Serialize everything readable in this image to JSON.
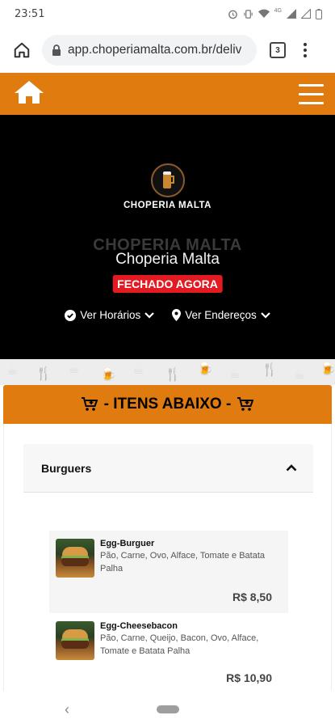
{
  "status_bar": {
    "time": "23:51",
    "network_label": "4G"
  },
  "browser": {
    "url": "app.choperiamalta.com.br/deliv",
    "tab_count": "3"
  },
  "site_nav": {
    "home_icon": "home-icon",
    "menu_icon": "hamburger-icon"
  },
  "hero": {
    "logo_text": "CHOPERIA MALTA",
    "ghost_title": "CHOPERIA MALTA",
    "store_name": "Choperia Malta",
    "status_badge": "FECHADO AGORA",
    "links": [
      {
        "label": "Ver Horários",
        "icon": "check-circle-icon"
      },
      {
        "label": "Ver Endereços",
        "icon": "map-pin-icon"
      }
    ]
  },
  "items_header": {
    "label": "- ITENS ABAIXO -",
    "icon": "cart-icon"
  },
  "category": {
    "title": "Burguers",
    "expanded": true
  },
  "products": [
    {
      "name": "Egg-Burguer",
      "description": "Pão, Carne, Ovo, Alface, Tomate e Batata Palha",
      "price": "R$ 8,50"
    },
    {
      "name": "Egg-Cheesebacon",
      "description": "Pão, Carne, Queijo, Bacon, Ovo, Alface, Tomate e Batata Palha",
      "price": "R$ 10,90"
    }
  ],
  "colors": {
    "brand_orange": "#e07b0f",
    "badge_red": "#e21b23",
    "hero_bg": "#000000"
  }
}
